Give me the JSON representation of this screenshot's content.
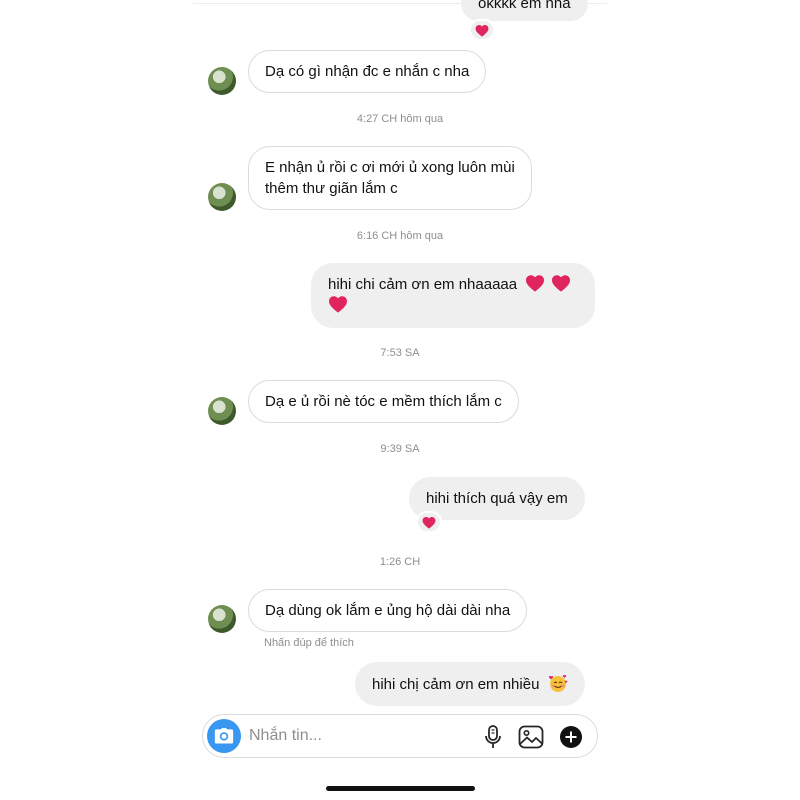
{
  "colors": {
    "accent": "#3897f0",
    "heart": "#e0245e",
    "bubble_out": "#efefef",
    "bubble_in_border": "#dbdbdb"
  },
  "messages": [
    {
      "dir": "out",
      "text": "okkkk em nha",
      "reaction": "heart-icon"
    },
    {
      "dir": "in",
      "text": "Dạ có gì nhận đc e nhắn c nha"
    },
    {
      "dir": "timestamp",
      "text": "4:27 CH hôm qua"
    },
    {
      "dir": "in",
      "line1": "E nhận ủ rồi c ơi mới ủ xong luôn mùi",
      "line2": "thêm thư giãn lắm c"
    },
    {
      "dir": "timestamp",
      "text": "6:16 CH hôm qua"
    },
    {
      "dir": "out",
      "text": "hihi chi cảm ơn em nhaaaaa",
      "emoji": [
        "heart-icon",
        "heart-icon",
        "heart-icon"
      ]
    },
    {
      "dir": "timestamp",
      "text": "7:53 SA"
    },
    {
      "dir": "in",
      "text": "Dạ e ủ rồi nè tóc e mềm thích lắm c"
    },
    {
      "dir": "timestamp",
      "text": "9:39 SA"
    },
    {
      "dir": "out",
      "text": "hihi thích quá vậy em",
      "reaction": "heart-icon"
    },
    {
      "dir": "timestamp",
      "text": "1:26 CH"
    },
    {
      "dir": "in",
      "text": "Dạ dùng ok lắm e ủng hộ dài dài nha"
    },
    {
      "dir": "out",
      "text": "hihi chị cảm ơn em nhiều",
      "emoji": [
        "smiling-face-with-hearts-icon"
      ]
    }
  ],
  "double_tap_hint": "Nhấn đúp để thích",
  "composer": {
    "placeholder": "Nhắn tin...",
    "icons": [
      "camera-icon",
      "microphone-icon",
      "image-icon",
      "plus-icon"
    ]
  }
}
